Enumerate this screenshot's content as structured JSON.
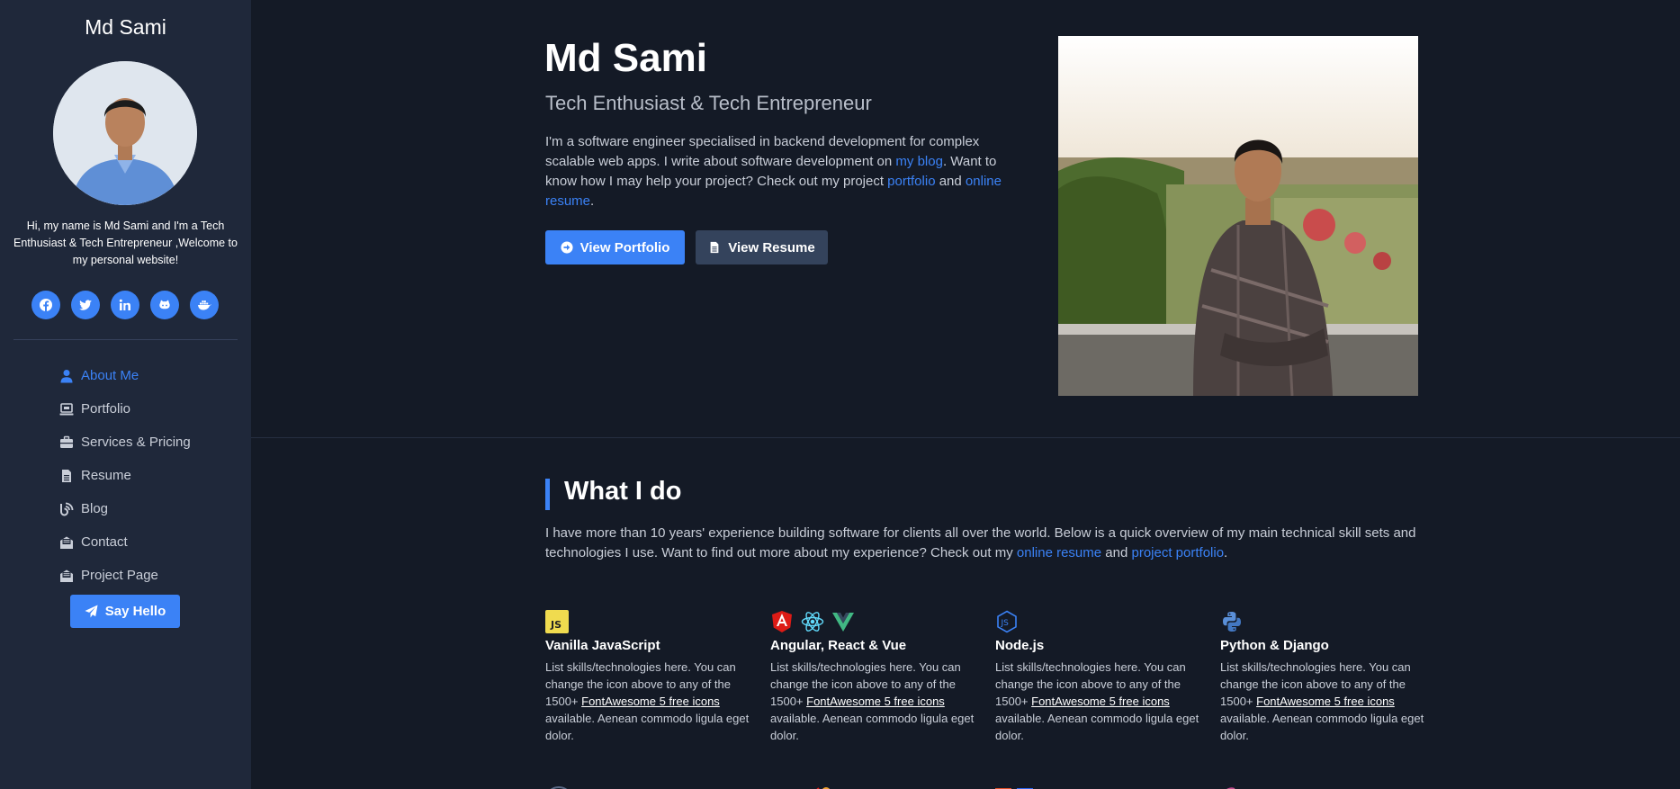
{
  "sidebar": {
    "site_name": "Md Sami",
    "bio": "Hi, my name is Md Sami and I'm a Tech Enthusiast & Tech Entrepreneur ,Welcome to my personal website!",
    "social": [
      {
        "name": "facebook-icon"
      },
      {
        "name": "twitter-icon"
      },
      {
        "name": "linkedin-icon"
      },
      {
        "name": "github-icon"
      },
      {
        "name": "docker-icon"
      }
    ],
    "nav": [
      {
        "label": "About Me",
        "icon": "user-icon",
        "active": true
      },
      {
        "label": "Portfolio",
        "icon": "laptop-icon"
      },
      {
        "label": "Services & Pricing",
        "icon": "briefcase-icon"
      },
      {
        "label": "Resume",
        "icon": "file-icon"
      },
      {
        "label": "Blog",
        "icon": "blog-icon"
      },
      {
        "label": "Contact",
        "icon": "envelope-open-icon"
      },
      {
        "label": "Project Page",
        "icon": "envelope-open-icon"
      }
    ],
    "say_hello": "Say Hello"
  },
  "hero": {
    "name": "Md Sami",
    "tagline": "Tech Enthusiast & Tech Entrepreneur",
    "intro_1": "I'm a software engineer specialised in backend development for complex scalable web apps. I write about software development on ",
    "intro_link_blog": "my blog",
    "intro_2": ". Want to know how I may help your project? Check out my project ",
    "intro_link_portfolio": "portfolio",
    "intro_3": " and ",
    "intro_link_resume": "online resume",
    "intro_4": ".",
    "btn_portfolio": "View Portfolio",
    "btn_resume": "View Resume"
  },
  "what_i_do": {
    "title": "What I do",
    "intro_1": "I have more than 10 years' experience building software for clients all over the world. Below is a quick overview of my main technical skill sets and technologies I use. Want to find out more about my experience? Check out my ",
    "link_resume": "online resume",
    "intro_2": " and ",
    "link_portfolio": "project portfolio",
    "intro_3": ".",
    "skills": [
      {
        "title": "Vanilla JavaScript",
        "icons": [
          "js-icon"
        ]
      },
      {
        "title": "Angular, React & Vue",
        "icons": [
          "angular-icon",
          "react-icon",
          "vue-icon"
        ]
      },
      {
        "title": "Node.js",
        "icons": [
          "nodejs-icon"
        ]
      },
      {
        "title": "Python & Django",
        "icons": [
          "python-icon"
        ]
      }
    ],
    "skill_desc_1": "List skills/technologies here. You can change the icon above to any of the 1500+ ",
    "skill_desc_link": "FontAwesome 5 free icons",
    "skill_desc_2": " available. Aenean commodo ligula eget dolor."
  },
  "colors": {
    "accent": "#3b82f6",
    "sidebar_bg": "#1f283a",
    "main_bg": "#141a26"
  }
}
